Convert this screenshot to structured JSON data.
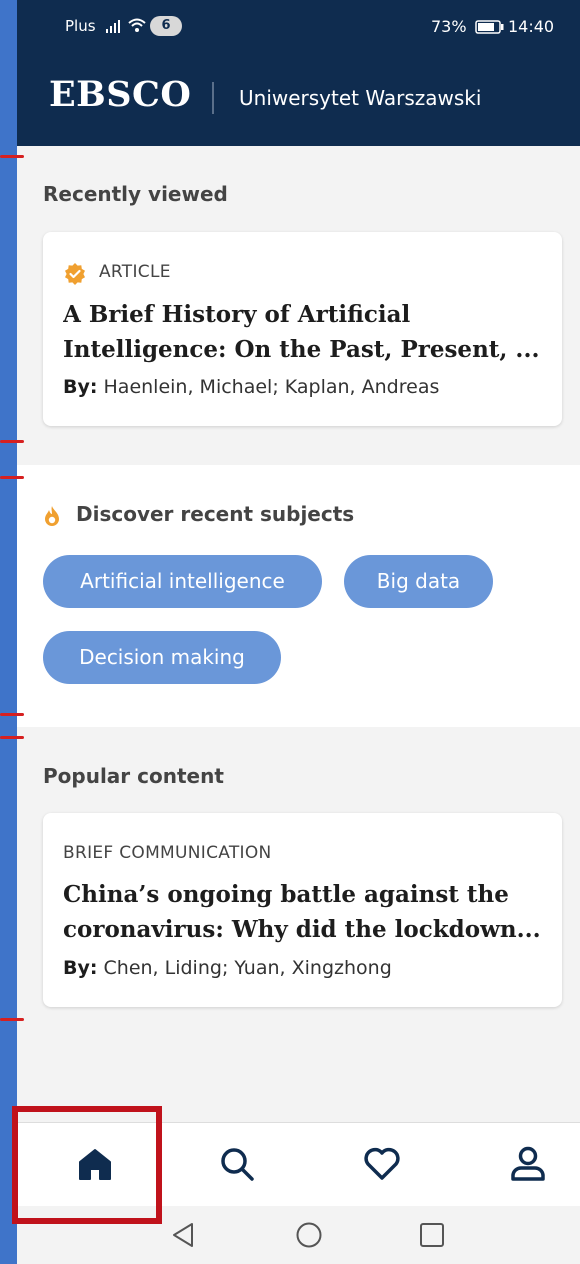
{
  "status_bar": {
    "carrier": "Plus",
    "notification_count": "6",
    "battery": "73%",
    "time": "14:40"
  },
  "header": {
    "logo": "EBSCO",
    "institution": "Uniwersytet Warszawski"
  },
  "recently_viewed": {
    "title": "Recently viewed",
    "card": {
      "type": "ARTICLE",
      "title_line1": "A Brief History of Artificial",
      "title_line2": "Intelligence: On the Past, Present, ...",
      "authors_label": "By:",
      "authors": "Haenlein, Michael; Kaplan, Andreas"
    }
  },
  "discover": {
    "title": "Discover recent subjects",
    "subjects": [
      "Artificial intelligence",
      "Big data",
      "Decision making"
    ]
  },
  "popular": {
    "title": "Popular content",
    "card": {
      "type": "BRIEF COMMUNICATION",
      "title_line1": "China’s ongoing battle against the",
      "title_line2": "coronavirus: Why did the lockdown...",
      "authors_label": "By:",
      "authors": "Chen, Liding; Yuan, Xingzhong"
    }
  },
  "bottom_nav": {
    "items": [
      "home-icon",
      "search-icon",
      "heart-icon",
      "profile-icon"
    ],
    "active": "home-icon"
  },
  "colors": {
    "header_bg": "#0f2c4f",
    "chip_bg": "#6a97d9",
    "accent_orange": "#f0a030",
    "highlight_red": "#c0121b"
  }
}
